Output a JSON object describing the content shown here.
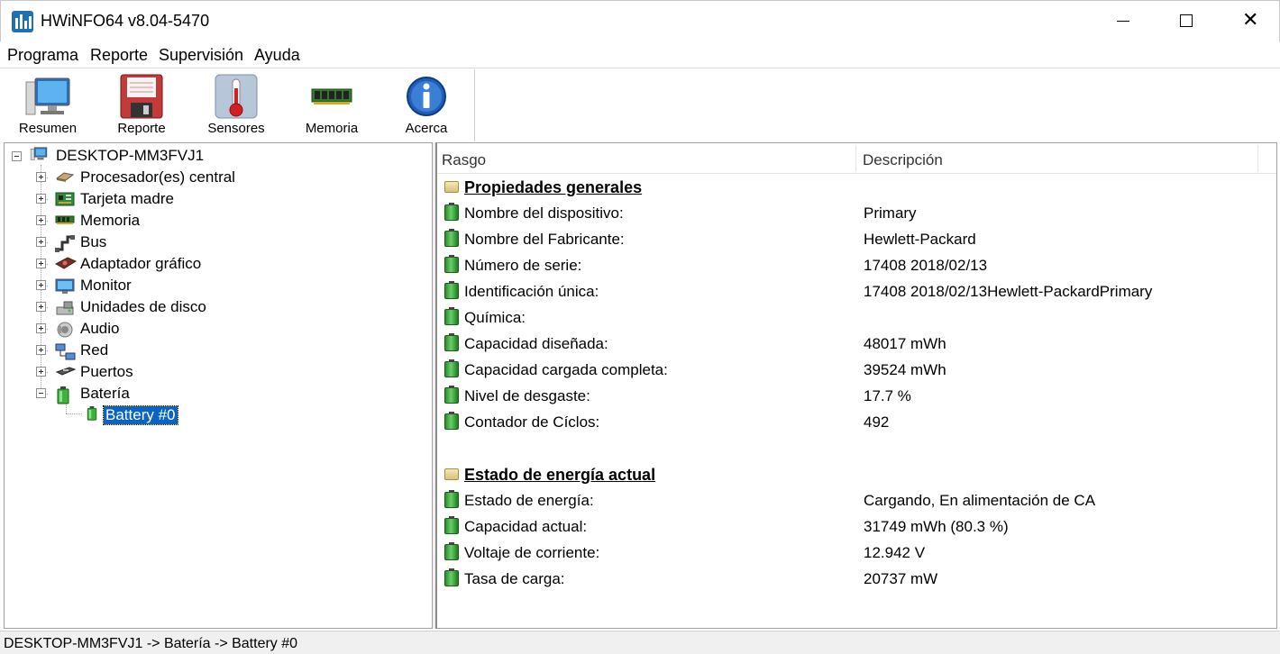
{
  "window": {
    "title": "HWiNFO64 v8.04-5470",
    "minimize_icon": "minimize-icon",
    "maximize_icon": "maximize-icon",
    "close_glyph": "✕"
  },
  "menu": [
    "Programa",
    "Reporte",
    "Supervisión",
    "Ayuda"
  ],
  "toolbar": [
    {
      "label": "Resumen",
      "icon": "monitor-icon"
    },
    {
      "label": "Reporte",
      "icon": "floppy-icon"
    },
    {
      "label": "Sensores",
      "icon": "thermometer-icon"
    },
    {
      "label": "Memoria",
      "icon": "ram-icon"
    },
    {
      "label": "Acerca",
      "icon": "info-icon"
    }
  ],
  "tree": {
    "root": "DESKTOP-MM3FVJ1",
    "items": [
      {
        "label": "Procesador(es) central",
        "icon": "cpu-icon",
        "expanded": false
      },
      {
        "label": "Tarjeta madre",
        "icon": "motherboard-icon",
        "expanded": false
      },
      {
        "label": "Memoria",
        "icon": "ram-icon",
        "expanded": false
      },
      {
        "label": "Bus",
        "icon": "bus-icon",
        "expanded": false
      },
      {
        "label": "Adaptador gráfico",
        "icon": "gpu-icon",
        "expanded": false
      },
      {
        "label": "Monitor",
        "icon": "monitor-icon",
        "expanded": false
      },
      {
        "label": "Unidades de disco",
        "icon": "disk-icon",
        "expanded": false
      },
      {
        "label": "Audio",
        "icon": "speaker-icon",
        "expanded": false
      },
      {
        "label": "Red",
        "icon": "network-icon",
        "expanded": false
      },
      {
        "label": "Puertos",
        "icon": "port-icon",
        "expanded": false
      },
      {
        "label": "Batería",
        "icon": "battery-icon",
        "expanded": true
      }
    ],
    "selected_child": "Battery #0"
  },
  "details": {
    "columns": [
      "Rasgo",
      "Descripción"
    ],
    "rows": [
      {
        "type": "section",
        "key": "Propiedades generales",
        "value": ""
      },
      {
        "type": "item",
        "key": "Nombre del dispositivo:",
        "value": "Primary"
      },
      {
        "type": "item",
        "key": "Nombre del Fabricante:",
        "value": "Hewlett-Packard"
      },
      {
        "type": "item",
        "key": "Número de serie:",
        "value": "17408 2018/02/13"
      },
      {
        "type": "item",
        "key": "Identificación única:",
        "value": "17408 2018/02/13Hewlett-PackardPrimary"
      },
      {
        "type": "item",
        "key": "Química:",
        "value": ""
      },
      {
        "type": "item",
        "key": "Capacidad diseñada:",
        "value": "48017 mWh"
      },
      {
        "type": "item",
        "key": "Capacidad cargada completa:",
        "value": "39524 mWh"
      },
      {
        "type": "item",
        "key": "Nivel de desgaste:",
        "value": "17.7 %"
      },
      {
        "type": "item",
        "key": "Contador de Cíclos:",
        "value": "492"
      },
      {
        "type": "blank",
        "key": "",
        "value": ""
      },
      {
        "type": "section",
        "key": "Estado de energía actual",
        "value": ""
      },
      {
        "type": "item",
        "key": "Estado de energía:",
        "value": "Cargando, En alimentación de CA"
      },
      {
        "type": "item",
        "key": "Capacidad actual:",
        "value": "31749 mWh (80.3 %)"
      },
      {
        "type": "item",
        "key": "Voltaje de corriente:",
        "value": "12.942 V"
      },
      {
        "type": "item",
        "key": "Tasa de carga:",
        "value": "20737 mW"
      }
    ]
  },
  "statusbar": "DESKTOP-MM3FVJ1 -> Batería -> Battery #0",
  "colors": {
    "selection": "#0a64c8",
    "battery": "#3cb43c",
    "app_icon": "#1f6fb5"
  }
}
